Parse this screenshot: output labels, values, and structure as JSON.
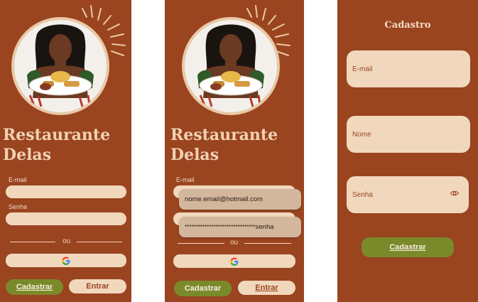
{
  "login_screen": {
    "brand_line1": "Restaurante",
    "brand_line2": "Delas",
    "email_label": "E-mail",
    "password_label": "Senha",
    "divider_text": "ou",
    "register_button": "Cadastrar",
    "login_button": "Entrar"
  },
  "login_autofill_screen": {
    "brand_line1": "Restaurante",
    "brand_line2": "Delas",
    "email_label": "E-mail",
    "email_suggestion": "nome.email@hotmail.com",
    "password_suggestion_mask": "********************************",
    "password_suggestion_label": "senha",
    "divider_text": "ou",
    "register_button": "Cadastrar",
    "login_button": "Entrar"
  },
  "register_screen": {
    "title": "Cadastro",
    "email_placeholder": "E-mail",
    "name_placeholder": "Nome",
    "password_placeholder": "Senha",
    "register_button": "Cadastrar"
  },
  "icons": {
    "google": "google-icon",
    "eye": "eye-icon"
  },
  "colors": {
    "background": "#9a4420",
    "field": "#f1d8bd",
    "brand_text": "#f0d2b3",
    "accent_green": "#7a8a2a"
  }
}
